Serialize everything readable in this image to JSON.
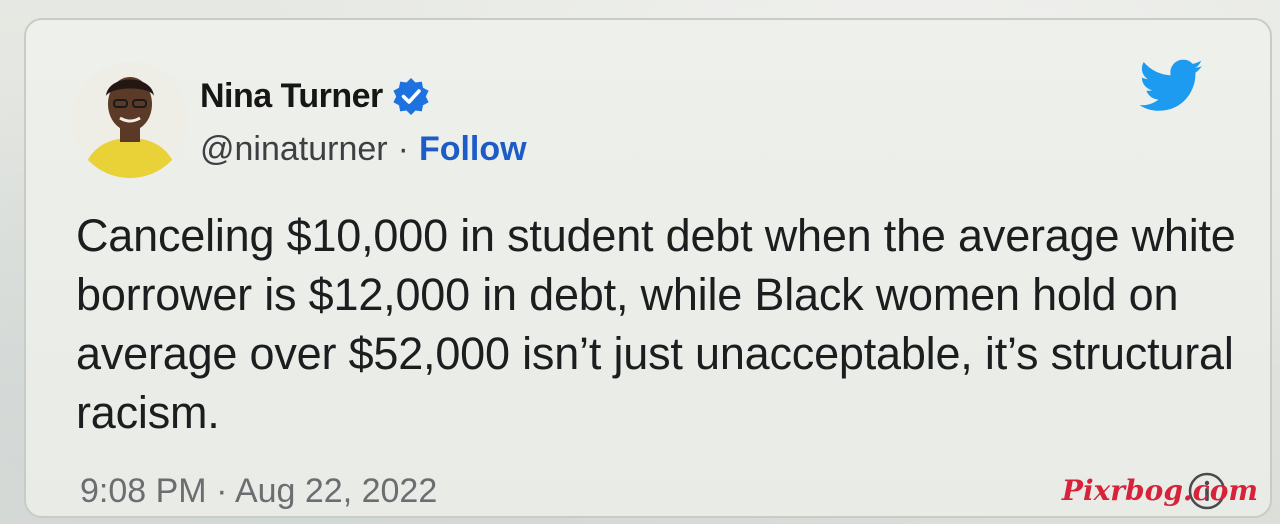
{
  "tweet": {
    "author": {
      "display_name": "Nina Turner",
      "handle": "@ninaturner",
      "separator": "·",
      "follow_label": "Follow",
      "verified": true,
      "avatar_icon": "profile-photo"
    },
    "text": "Canceling $10,000 in student debt when the average white borrower is $12,000 in debt, while Black women hold on average over $52,000 isn’t just unacceptable, it’s structural racism.",
    "timestamp": "9:08 PM · Aug 22, 2022"
  },
  "brand": {
    "icon": "twitter-bird-icon",
    "color": "#1d9bf0",
    "verified_color": "#1d72e0",
    "follow_color": "#1d5cc7"
  },
  "watermark": {
    "text": "Pixrbog.com",
    "color": "#d6233a"
  }
}
